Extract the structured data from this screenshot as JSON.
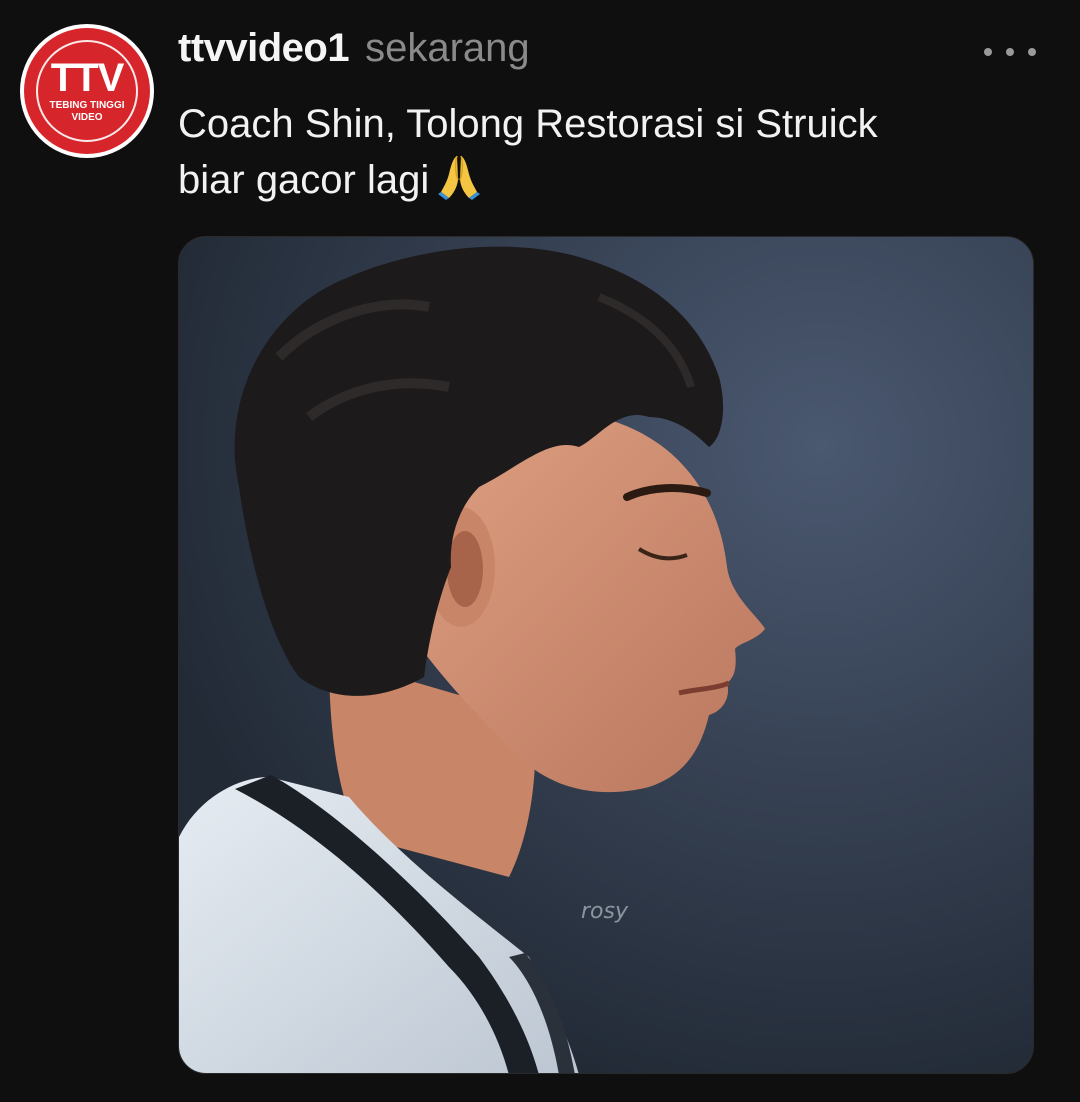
{
  "post": {
    "avatar": {
      "logo_text": "TTV",
      "sub_line1": "TEBING TINGGI",
      "sub_line2": "VIDEO",
      "brand_color": "#d7262b"
    },
    "username": "ttvvideo1",
    "timestamp": "sekarang",
    "more_icon": "more-horizontal-icon",
    "caption_line1": "Coach Shin, Tolong Restorasi si Struick",
    "caption_line2": "biar gacor lagi",
    "caption_emoji": "folded-hands-emoji",
    "media": {
      "watermark": "rosy"
    }
  },
  "colors": {
    "background": "#0f0f0f",
    "text_primary": "#f2f2f2",
    "text_secondary": "#8a8a8a"
  }
}
